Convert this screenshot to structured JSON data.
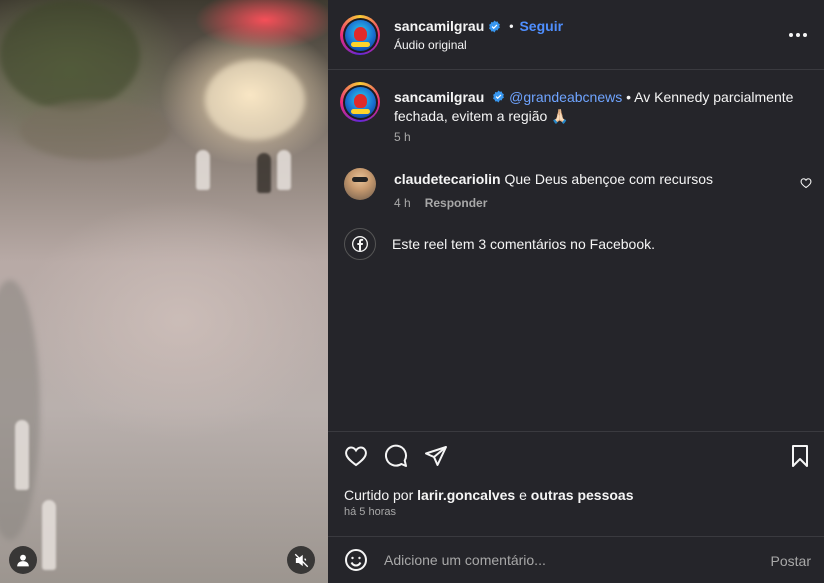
{
  "post": {
    "username": "sancamilgrau",
    "follow_label": "Seguir",
    "separator": "•",
    "audio": "Áudio original"
  },
  "caption": {
    "username": "sancamilgrau",
    "mention": "@grandeabcnews",
    "text": " • Av Kennedy parcialmente fechada, evitem a região 🙏🏻",
    "time": "5 h"
  },
  "comments": [
    {
      "username": "claudetecariolin",
      "text": " Que Deus abençoe com recursos",
      "time": "4 h",
      "reply_label": "Responder"
    }
  ],
  "facebook_note": "Este reel tem 3 comentários no Facebook.",
  "likes": {
    "prefix": "Curtido por ",
    "user": "larir.goncalves",
    "connector": " e ",
    "others": "outras pessoas"
  },
  "posted_ago": "há 5 horas",
  "comment_box": {
    "placeholder": "Adicione um comentário...",
    "post_label": "Postar"
  },
  "icons": {
    "verified": "verified-badge-icon",
    "more": "more-options-icon",
    "like": "heart-icon",
    "comment": "comment-bubble-icon",
    "share": "paper-plane-icon",
    "save": "bookmark-icon",
    "emoji": "emoji-icon",
    "facebook": "facebook-icon",
    "user": "user-tags-icon",
    "mute": "speaker-muted-icon"
  },
  "colors": {
    "panel_bg": "#25252a",
    "link": "#4f8fff",
    "muted_text": "#a8a8a8"
  }
}
